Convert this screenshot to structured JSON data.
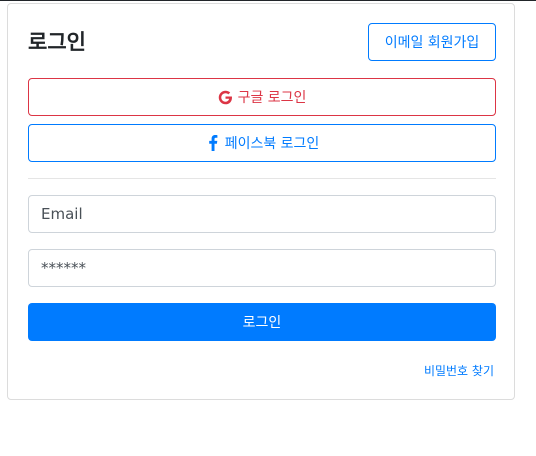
{
  "header": {
    "title": "로그인",
    "signup_label": "이메일 회원가입"
  },
  "social": {
    "google_label": "구글 로그인",
    "facebook_label": "페이스북 로그인",
    "google_icon": "google-icon",
    "facebook_icon": "facebook-icon"
  },
  "form": {
    "email_placeholder": "Email",
    "password_placeholder": "******",
    "login_label": "로그인",
    "forgot_label": "비밀번호 찾기"
  },
  "colors": {
    "primary": "#007bff",
    "danger": "#dc3545"
  }
}
